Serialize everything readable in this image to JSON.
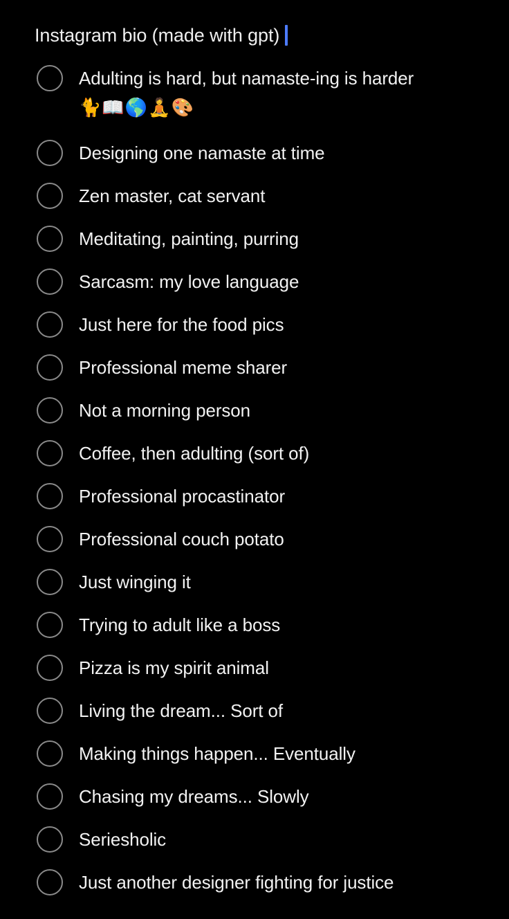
{
  "note": {
    "title": "Instagram bio (made with gpt)",
    "caret_color": "#4d7cfe",
    "background_color": "#000000",
    "text_color": "#f2f2f2",
    "checkbox_color": "#8a8a8a"
  },
  "checklist": {
    "items": [
      {
        "label": "Adulting is hard, but namaste-ing is harder",
        "emoji": "🐈📖🌎🧘🎨",
        "checked": false
      },
      {
        "label": "Designing one namaste at time",
        "emoji": "",
        "checked": false
      },
      {
        "label": "Zen master, cat servant",
        "emoji": "",
        "checked": false
      },
      {
        "label": "Meditating, painting, purring",
        "emoji": "",
        "checked": false
      },
      {
        "label": "Sarcasm: my love language",
        "emoji": "",
        "checked": false
      },
      {
        "label": "Just here for the food pics",
        "emoji": "",
        "checked": false
      },
      {
        "label": "Professional meme sharer",
        "emoji": "",
        "checked": false
      },
      {
        "label": "Not a morning person",
        "emoji": "",
        "checked": false
      },
      {
        "label": "Coffee, then adulting (sort of)",
        "emoji": "",
        "checked": false
      },
      {
        "label": "Professional procastinator",
        "emoji": "",
        "checked": false
      },
      {
        "label": "Professional couch potato",
        "emoji": "",
        "checked": false
      },
      {
        "label": "Just winging it",
        "emoji": "",
        "checked": false
      },
      {
        "label": "Trying to adult like a boss",
        "emoji": "",
        "checked": false
      },
      {
        "label": "Pizza is my spirit animal",
        "emoji": "",
        "checked": false
      },
      {
        "label": "Living the dream... Sort of",
        "emoji": "",
        "checked": false
      },
      {
        "label": "Making things happen... Eventually",
        "emoji": "",
        "checked": false
      },
      {
        "label": "Chasing my dreams... Slowly",
        "emoji": "",
        "checked": false
      },
      {
        "label": "Seriesholic",
        "emoji": "",
        "checked": false
      },
      {
        "label": "Just another designer fighting for justice",
        "emoji": "",
        "checked": false
      }
    ]
  }
}
